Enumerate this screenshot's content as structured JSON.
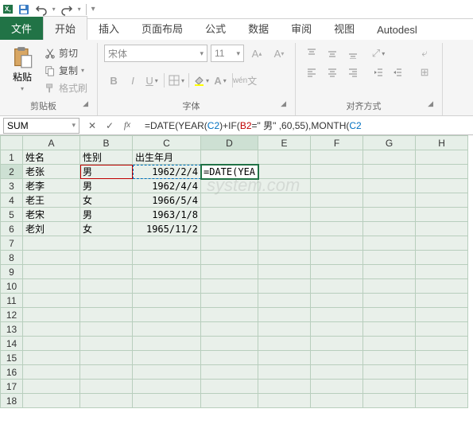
{
  "qat": {
    "excel": "X,"
  },
  "tabs": {
    "file": "文件",
    "home": "开始",
    "insert": "插入",
    "layout": "页面布局",
    "formula": "公式",
    "data": "数据",
    "review": "审阅",
    "view": "视图",
    "autodesk": "Autodesl"
  },
  "ribbon": {
    "paste": "粘贴",
    "cut": "剪切",
    "copy": "复制",
    "format_painter": "格式刷",
    "clipboard_label": "剪贴板",
    "font_name": "宋体",
    "font_size": "11",
    "font_label": "字体",
    "align_label": "对齐方式"
  },
  "namebox": "SUM",
  "formula": {
    "p1": "=DATE(YEAR(",
    "r1": "C2",
    "p2": ")+IF(",
    "r2": "B2",
    "p3": "=\" 男\" ,60,55),MONTH(",
    "r3": "C2"
  },
  "headers": {
    "row": [
      "1",
      "2",
      "3",
      "4",
      "5",
      "6",
      "7",
      "8",
      "9",
      "10",
      "11",
      "12",
      "13",
      "14",
      "15",
      "16",
      "17",
      "18"
    ],
    "col": [
      "A",
      "B",
      "C",
      "D",
      "E",
      "F",
      "G",
      "H"
    ]
  },
  "cells": {
    "A1": "姓名",
    "B1": "性别",
    "C1": "出生年月",
    "A2": "老张",
    "B2": "男",
    "C2": "1962/2/4",
    "D2": "=DATE(YEA",
    "A3": "老李",
    "B3": "男",
    "C3": "1962/4/4",
    "A4": "老王",
    "B4": "女",
    "C4": "1966/5/4",
    "A5": "老宋",
    "B5": "男",
    "C5": "1963/1/8",
    "A6": "老刘",
    "B6": "女",
    "C6": "1965/11/2"
  },
  "watermark": "system.com"
}
